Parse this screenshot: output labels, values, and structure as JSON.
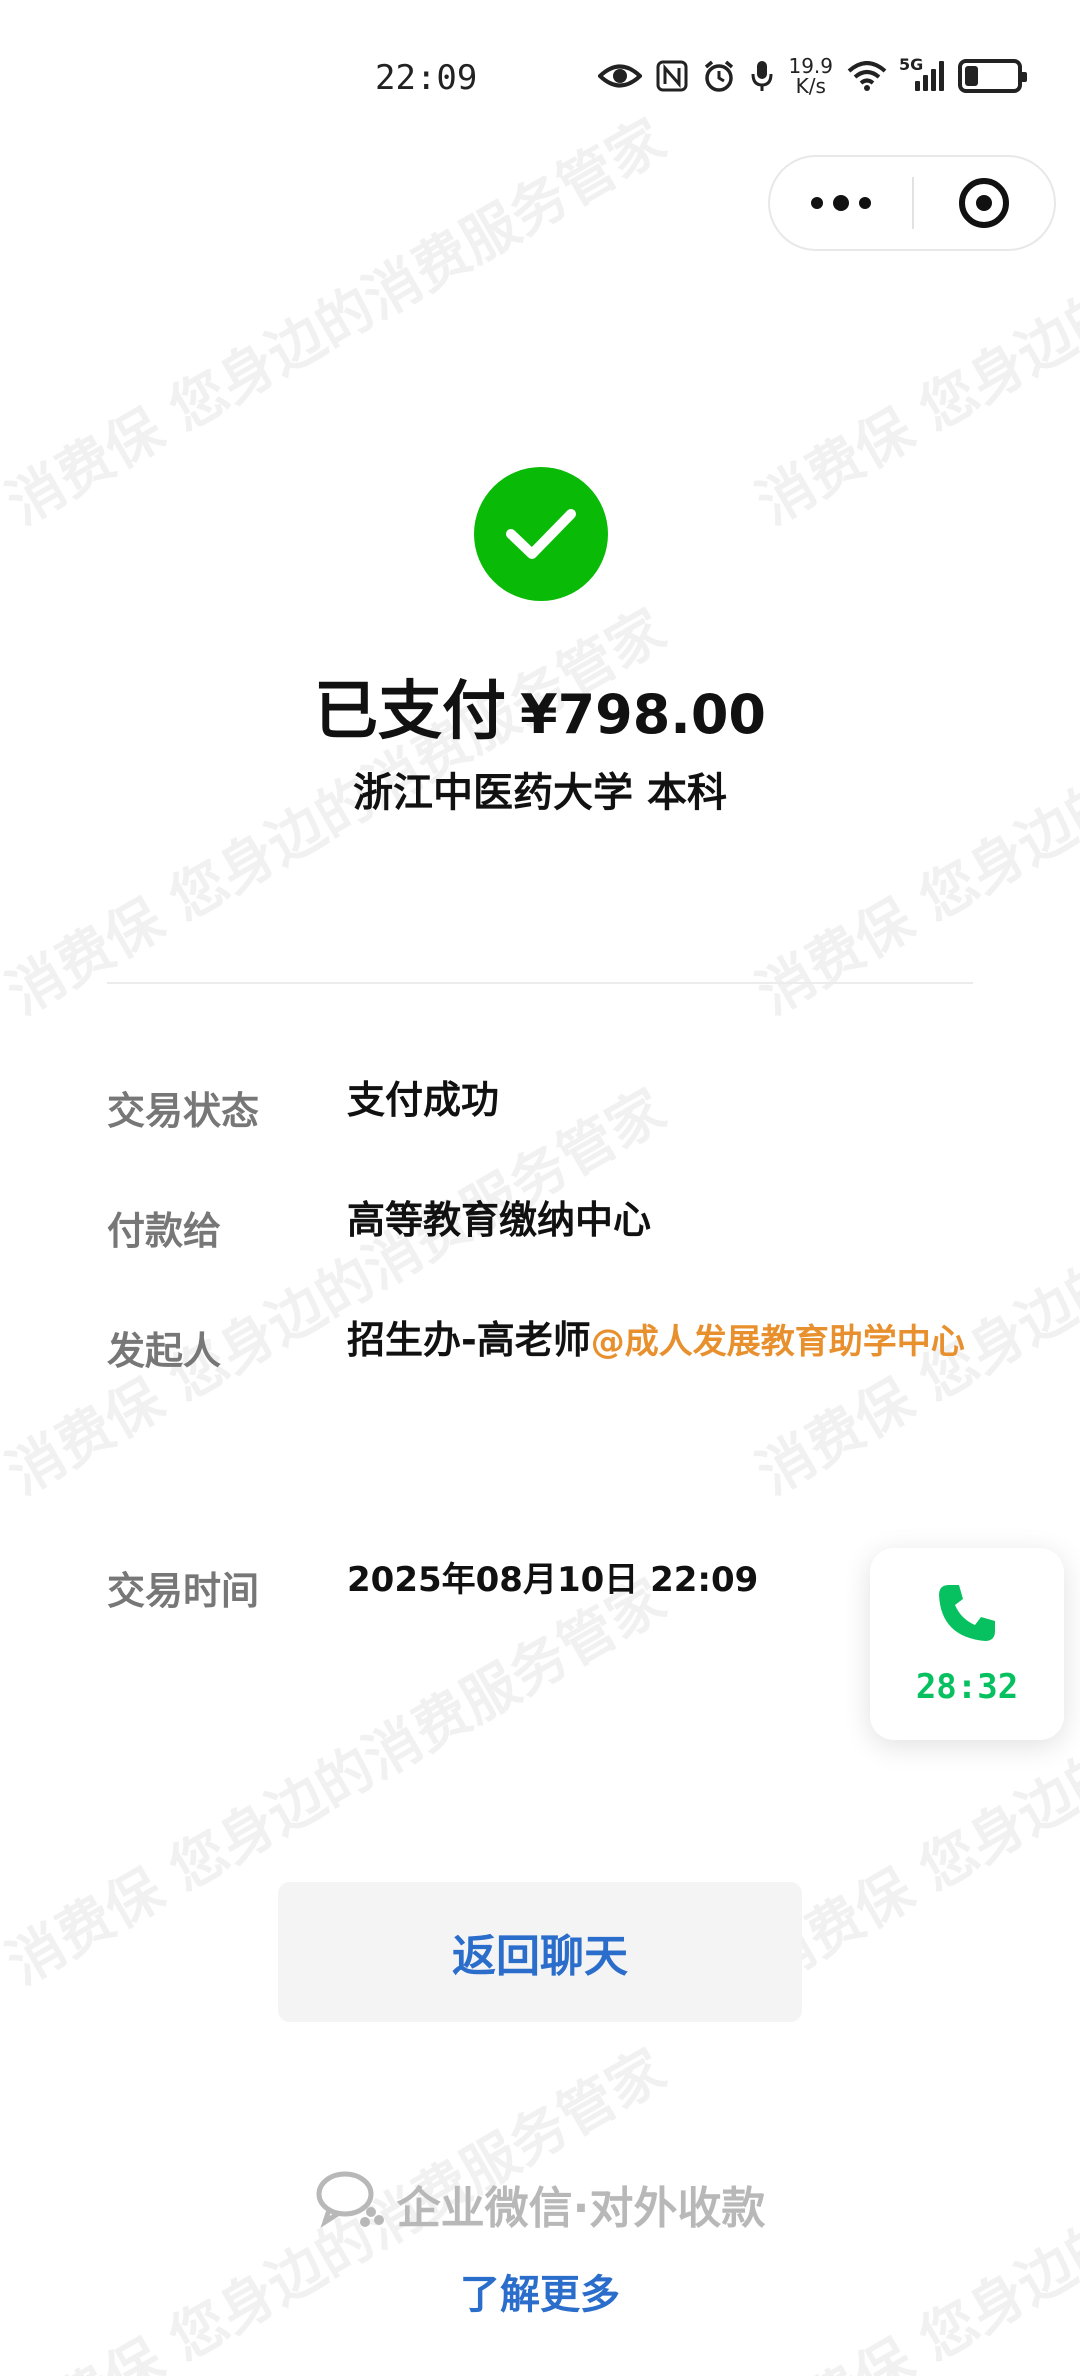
{
  "watermark": {
    "text": "消费保 您身边的消费服务管家"
  },
  "status_bar": {
    "time": "22:09",
    "net_speed_value": "19.9",
    "net_speed_unit": "K/s",
    "network": "5G",
    "battery_level": 0.25,
    "icons": [
      "eye-icon",
      "nfc-icon",
      "alarm-icon",
      "mic-icon",
      "wifi-icon",
      "signal-icon",
      "battery-icon"
    ]
  },
  "capsule": {
    "more_icon": "more-dots-icon",
    "close_icon": "target-close-icon"
  },
  "payment": {
    "status_title": "已支付",
    "amount": "¥798.00",
    "product": "浙江中医药大学 本科"
  },
  "details": {
    "rows": [
      {
        "label": "交易状态",
        "value": "支付成功"
      },
      {
        "label": "付款给",
        "value": "高等教育缴纳中心"
      },
      {
        "label": "发起人",
        "value": "招生办-高老师",
        "org": "@成人发展教育助学中心"
      },
      {
        "label": "交易时间",
        "value": "2025年08月10日 22:09"
      }
    ]
  },
  "call_float": {
    "icon": "phone-icon",
    "timer": "28:32"
  },
  "actions": {
    "back_label": "返回聊天"
  },
  "footer": {
    "brand_icon": "wecom-icon",
    "brand_text": "企业微信·对外收款",
    "learn_more": "了解更多"
  },
  "colors": {
    "success_green": "#09bb07",
    "call_green": "#07c160",
    "link_blue": "#2a6dcb",
    "org_orange": "#e8902e"
  }
}
